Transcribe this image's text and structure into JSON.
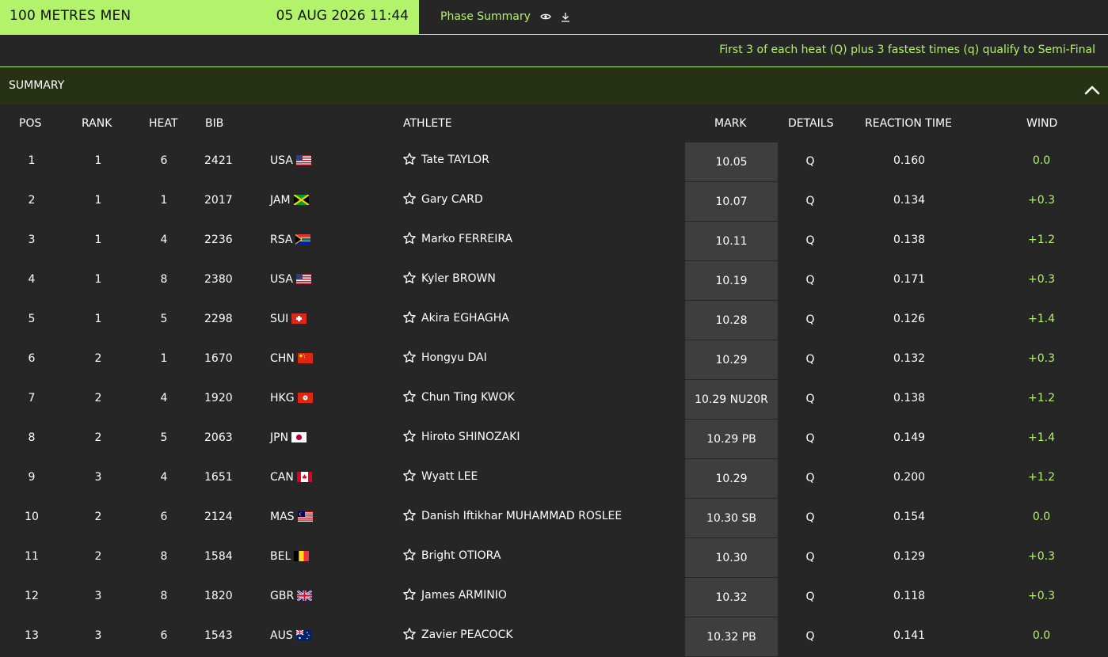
{
  "header": {
    "event_title": "100 METRES MEN",
    "event_datetime": "05 AUG 2026 11:44",
    "phase_label": "Phase Summary",
    "accent_color": "#b3f36b"
  },
  "qualification_note": "First 3 of each heat (Q) plus 3 fastest times (q) qualify to Semi-Final",
  "summary_title": "SUMMARY",
  "columns": {
    "pos": "POS",
    "rank": "RANK",
    "heat": "HEAT",
    "bib": "BIB",
    "athlete": "ATHLETE",
    "mark": "MARK",
    "details": "DETAILS",
    "reaction": "REACTION TIME",
    "wind": "WIND"
  },
  "rows": [
    {
      "pos": "1",
      "rank": "1",
      "heat": "6",
      "bib": "2421",
      "country": "USA",
      "flag": "usa",
      "athlete": "Tate TAYLOR",
      "mark": "10.05",
      "details": "Q",
      "reaction": "0.160",
      "wind": "0.0"
    },
    {
      "pos": "2",
      "rank": "1",
      "heat": "1",
      "bib": "2017",
      "country": "JAM",
      "flag": "jam",
      "athlete": "Gary CARD",
      "mark": "10.07",
      "details": "Q",
      "reaction": "0.134",
      "wind": "+0.3"
    },
    {
      "pos": "3",
      "rank": "1",
      "heat": "4",
      "bib": "2236",
      "country": "RSA",
      "flag": "rsa",
      "athlete": "Marko FERREIRA",
      "mark": "10.11",
      "details": "Q",
      "reaction": "0.138",
      "wind": "+1.2"
    },
    {
      "pos": "4",
      "rank": "1",
      "heat": "8",
      "bib": "2380",
      "country": "USA",
      "flag": "usa",
      "athlete": "Kyler BROWN",
      "mark": "10.19",
      "details": "Q",
      "reaction": "0.171",
      "wind": "+0.3"
    },
    {
      "pos": "5",
      "rank": "1",
      "heat": "5",
      "bib": "2298",
      "country": "SUI",
      "flag": "sui",
      "athlete": "Akira EGHAGHA",
      "mark": "10.28",
      "details": "Q",
      "reaction": "0.126",
      "wind": "+1.4"
    },
    {
      "pos": "6",
      "rank": "2",
      "heat": "1",
      "bib": "1670",
      "country": "CHN",
      "flag": "chn",
      "athlete": "Hongyu DAI",
      "mark": "10.29",
      "details": "Q",
      "reaction": "0.132",
      "wind": "+0.3"
    },
    {
      "pos": "7",
      "rank": "2",
      "heat": "4",
      "bib": "1920",
      "country": "HKG",
      "flag": "hkg",
      "athlete": "Chun Ting KWOK",
      "mark": "10.29 NU20R",
      "details": "Q",
      "reaction": "0.138",
      "wind": "+1.2"
    },
    {
      "pos": "8",
      "rank": "2",
      "heat": "5",
      "bib": "2063",
      "country": "JPN",
      "flag": "jpn",
      "athlete": "Hiroto SHINOZAKI",
      "mark": "10.29 PB",
      "details": "Q",
      "reaction": "0.149",
      "wind": "+1.4"
    },
    {
      "pos": "9",
      "rank": "3",
      "heat": "4",
      "bib": "1651",
      "country": "CAN",
      "flag": "can",
      "athlete": "Wyatt LEE",
      "mark": "10.29",
      "details": "Q",
      "reaction": "0.200",
      "wind": "+1.2"
    },
    {
      "pos": "10",
      "rank": "2",
      "heat": "6",
      "bib": "2124",
      "country": "MAS",
      "flag": "mas",
      "athlete": "Danish Iftikhar MUHAMMAD ROSLEE",
      "mark": "10.30 SB",
      "details": "Q",
      "reaction": "0.154",
      "wind": "0.0"
    },
    {
      "pos": "11",
      "rank": "2",
      "heat": "8",
      "bib": "1584",
      "country": "BEL",
      "flag": "bel",
      "athlete": "Bright OTIORA",
      "mark": "10.30",
      "details": "Q",
      "reaction": "0.129",
      "wind": "+0.3"
    },
    {
      "pos": "12",
      "rank": "3",
      "heat": "8",
      "bib": "1820",
      "country": "GBR",
      "flag": "gbr",
      "athlete": "James ARMINIO",
      "mark": "10.32",
      "details": "Q",
      "reaction": "0.118",
      "wind": "+0.3"
    },
    {
      "pos": "13",
      "rank": "3",
      "heat": "6",
      "bib": "1543",
      "country": "AUS",
      "flag": "aus",
      "athlete": "Zavier PEACOCK",
      "mark": "10.32 PB",
      "details": "Q",
      "reaction": "0.141",
      "wind": "0.0"
    }
  ],
  "icons": {
    "phase_view": "eye-icon",
    "phase_download": "download-icon",
    "collapse": "chevron-up-icon",
    "favorite": "star-outline-icon"
  }
}
